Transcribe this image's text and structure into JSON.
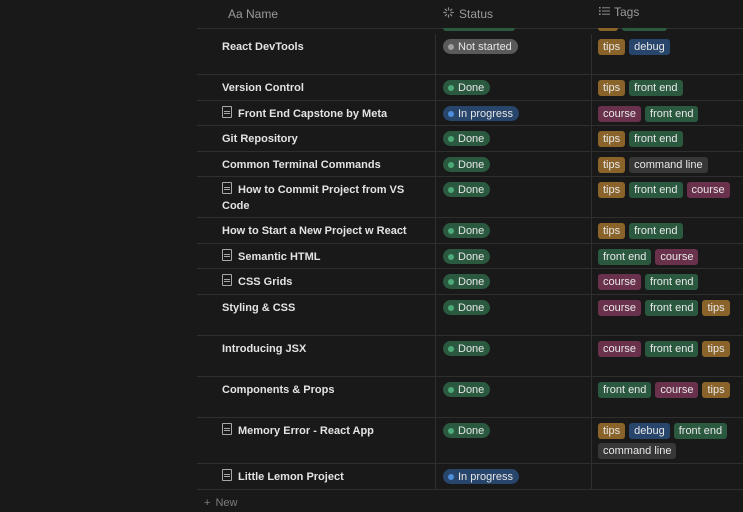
{
  "header": {
    "name_label": "Aa Name",
    "status_label": "Status",
    "tags_label": "Tags"
  },
  "rows": [
    {
      "name": "React DevTools",
      "doc": false,
      "status": "Not started",
      "status_key": "notstarted",
      "tags": [
        "tips",
        "debug"
      ],
      "h": 41
    },
    {
      "name": "Version Control",
      "doc": false,
      "status": "Done",
      "status_key": "done",
      "tags": [
        "tips",
        "front end"
      ],
      "h": 26
    },
    {
      "name": "Front End Capstone by Meta",
      "doc": true,
      "status": "In progress",
      "status_key": "progress",
      "tags": [
        "course",
        "front end"
      ],
      "h": 25
    },
    {
      "name": "Git Repository",
      "doc": false,
      "status": "Done",
      "status_key": "done",
      "tags": [
        "tips",
        "front end"
      ],
      "h": 26
    },
    {
      "name": "Common Terminal Commands",
      "doc": false,
      "status": "Done",
      "status_key": "done",
      "tags": [
        "tips",
        "command line"
      ],
      "h": 25
    },
    {
      "name": "How to Commit Project from VS Code",
      "doc": true,
      "status": "Done",
      "status_key": "done",
      "tags": [
        "tips",
        "front end",
        "course"
      ],
      "h": 41
    },
    {
      "name": "How to Start a New Project w React",
      "doc": false,
      "status": "Done",
      "status_key": "done",
      "tags": [
        "tips",
        "front end"
      ],
      "h": 26
    },
    {
      "name": "Semantic HTML",
      "doc": true,
      "status": "Done",
      "status_key": "done",
      "tags": [
        "front end",
        "course"
      ],
      "h": 25
    },
    {
      "name": "CSS Grids",
      "doc": true,
      "status": "Done",
      "status_key": "done",
      "tags": [
        "course",
        "front end"
      ],
      "h": 26
    },
    {
      "name": "Styling & CSS",
      "doc": false,
      "status": "Done",
      "status_key": "done",
      "tags": [
        "course",
        "front end",
        "tips"
      ],
      "h": 41
    },
    {
      "name": "Introducing JSX",
      "doc": false,
      "status": "Done",
      "status_key": "done",
      "tags": [
        "course",
        "front end",
        "tips"
      ],
      "h": 41
    },
    {
      "name": "Components & Props",
      "doc": false,
      "status": "Done",
      "status_key": "done",
      "tags": [
        "front end",
        "course",
        "tips"
      ],
      "h": 41
    },
    {
      "name": "Memory Error - React App",
      "doc": true,
      "status": "Done",
      "status_key": "done",
      "tags": [
        "tips",
        "debug",
        "front end",
        "command line"
      ],
      "h": 46
    },
    {
      "name": "Little Lemon Project",
      "doc": true,
      "status": "In progress",
      "status_key": "progress",
      "tags": [],
      "h": 26
    }
  ],
  "new_label": "New",
  "tag_colors": {
    "tips": "#89632a",
    "debug": "#28456c",
    "front end": "#2b593f",
    "course": "#69314c",
    "command line": "#373737"
  }
}
